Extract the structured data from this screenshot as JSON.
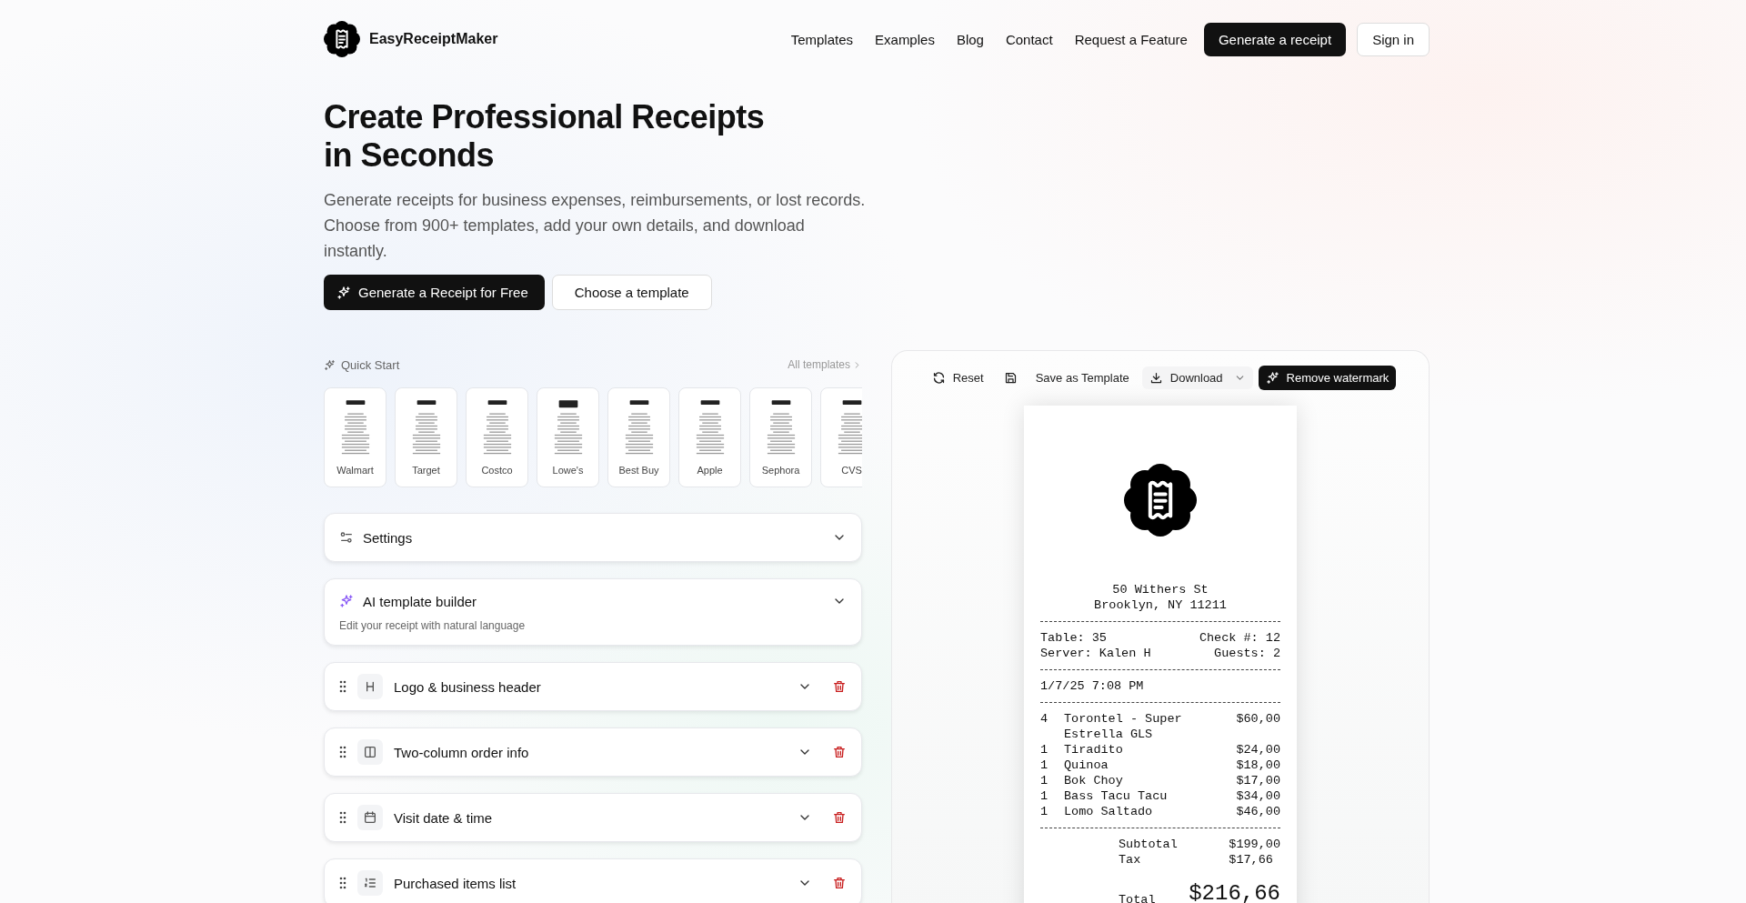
{
  "header": {
    "brand": "EasyReceiptMaker",
    "nav_links": [
      "Templates",
      "Examples",
      "Blog",
      "Contact",
      "Request a Feature"
    ],
    "primary_button": "Generate a receipt",
    "secondary_button": "Sign in"
  },
  "hero": {
    "title": "Create Professional Receipts in Seconds",
    "subtitle": "Generate receipts for business expenses, reimbursements, or lost records. Choose from 900+ templates, add your own details, and download instantly.",
    "primary_button": "Generate a Receipt for Free",
    "secondary_button": "Choose a template"
  },
  "quick_start": {
    "label": "Quick Start",
    "link": "All templates",
    "templates": [
      {
        "name": "Walmart"
      },
      {
        "name": "Target"
      },
      {
        "name": "Costco"
      },
      {
        "name": "Lowe's"
      },
      {
        "name": "Best Buy"
      },
      {
        "name": "Apple"
      },
      {
        "name": "Sephora"
      },
      {
        "name": "CVS"
      }
    ]
  },
  "settings": {
    "title": "Settings",
    "expanded": false
  },
  "ai_builder": {
    "title": "AI template builder",
    "subtitle": "Edit your receipt with natural language",
    "expanded": false
  },
  "sections": [
    {
      "title": "Logo & business header",
      "kind": "heading",
      "expanded": false
    },
    {
      "title": "Two-column order info",
      "kind": "columns",
      "expanded": false
    },
    {
      "title": "Visit date & time",
      "kind": "calendar",
      "expanded": false
    },
    {
      "title": "Purchased items list",
      "kind": "list",
      "expanded": false
    }
  ],
  "toolbar": [
    {
      "label": "Reset",
      "kind": "reset"
    },
    {
      "label": "Save as Template",
      "kind": "save"
    },
    {
      "label": "Download",
      "kind": "download"
    },
    {
      "label": "Remove watermark",
      "kind": "premium"
    }
  ],
  "receipt": {
    "address": [
      "50 Withers St",
      "Brooklyn, NY 11211"
    ],
    "info_rows": [
      {
        "left": "Table: 35",
        "right": "Check #: 12"
      },
      {
        "left": "Server: Kalen H",
        "right": "Guests: 2"
      }
    ],
    "datetime": "1/7/25 7:08 PM",
    "items": [
      {
        "qty": "4",
        "name": "Torontel - Super Estrella GLS",
        "price": "$60,00"
      },
      {
        "qty": "1",
        "name": "Tiradito",
        "price": "$24,00"
      },
      {
        "qty": "1",
        "name": "Quinoa",
        "price": "$18,00"
      },
      {
        "qty": "1",
        "name": "Bok Choy",
        "price": "$17,00"
      },
      {
        "qty": "1",
        "name": "Bass Tacu Tacu",
        "price": "$34,00"
      },
      {
        "qty": "1",
        "name": "Lomo Saltado",
        "price": "$46,00"
      }
    ],
    "totals": [
      {
        "label": "Subtotal",
        "value": "$199,00"
      },
      {
        "label": "Tax",
        "value": "$17,66"
      }
    ],
    "total": {
      "label": "Total",
      "value": "$216,66"
    }
  }
}
